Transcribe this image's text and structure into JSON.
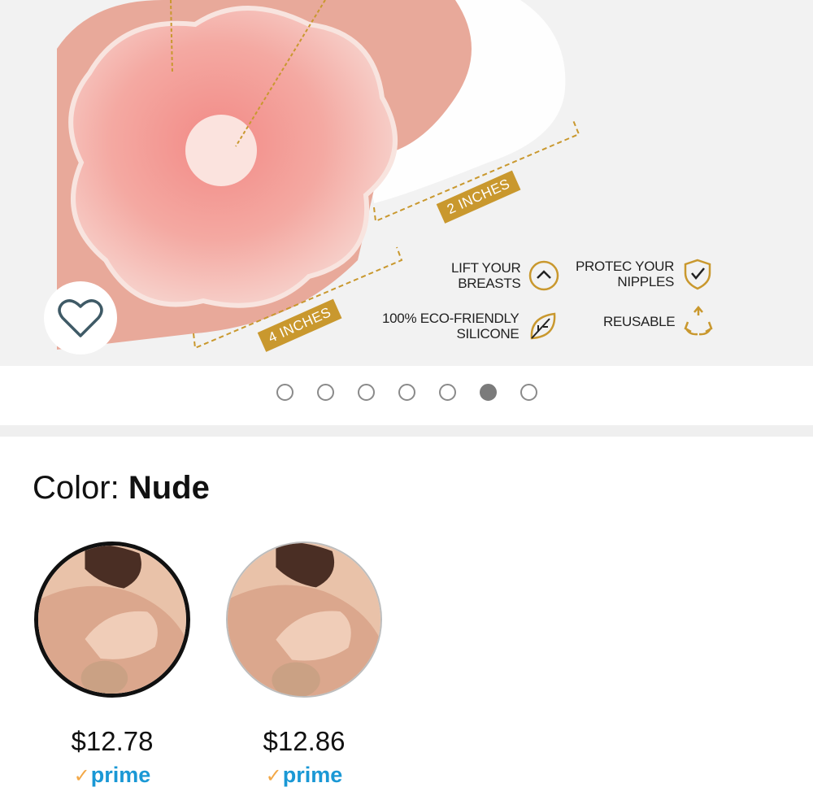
{
  "product_image": {
    "size_tags": [
      "2 INCHES",
      "4 INCHES"
    ],
    "features": [
      {
        "label": "LIFT YOUR\nBREASTS",
        "icon": "lift-chevron-icon"
      },
      {
        "label": "PROTEC YOUR\nNIPPLES",
        "icon": "shield-check-icon"
      },
      {
        "label": "100% ECO-FRIENDLY\nSILICONE",
        "icon": "leaf-icon"
      },
      {
        "label": "REUSABLE",
        "icon": "recycle-icon"
      }
    ],
    "accent_color": "#c9982e"
  },
  "wishlist": {
    "icon": "heart-icon"
  },
  "carousel": {
    "total": 7,
    "active_index": 5
  },
  "color_selector": {
    "prefix": "Color: ",
    "selected_value": "Nude",
    "options": [
      {
        "price": "$12.78",
        "prime": "prime",
        "selected": true
      },
      {
        "price": "$12.86",
        "prime": "prime",
        "selected": false
      }
    ]
  },
  "prime_check": "✓"
}
